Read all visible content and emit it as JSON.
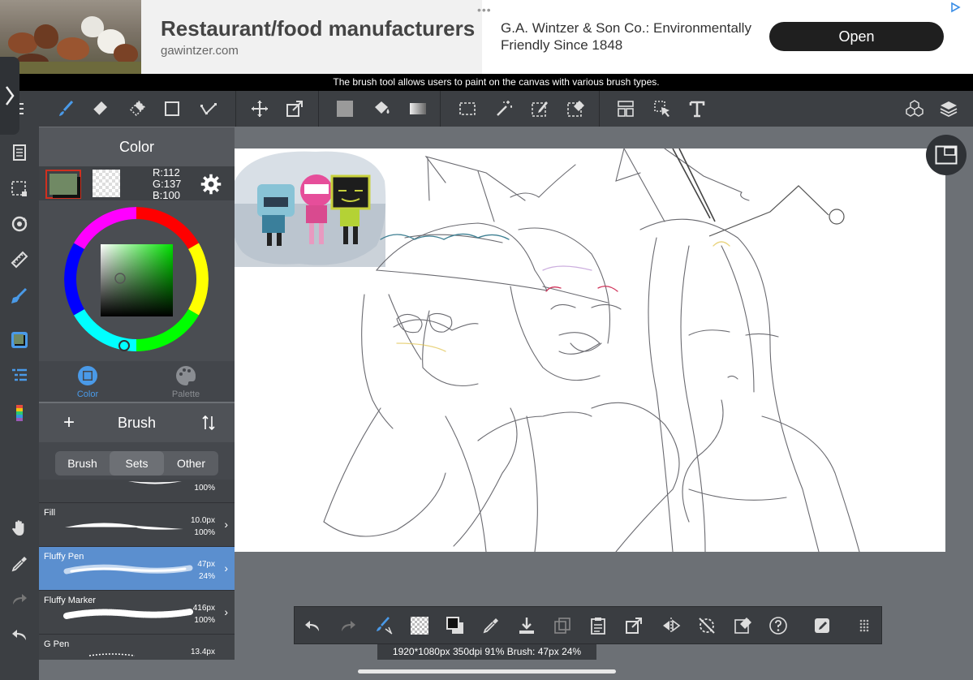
{
  "ad": {
    "title": "Restaurant/food manufacturers",
    "url": "gawintzer.com",
    "description": "G.A. Wintzer & Son Co.: Environmentally Friendly Since 1848",
    "open_label": "Open",
    "dots": "•••"
  },
  "tooltip": "The brush tool allows users to paint on the canvas with various brush types.",
  "color_panel": {
    "title": "Color",
    "rgb": {
      "r": "R:112",
      "g": "G:137",
      "b": "B:100"
    },
    "fg_color": "#708964",
    "tabs": [
      {
        "label": "Color",
        "active": true
      },
      {
        "label": "Palette",
        "active": false
      }
    ]
  },
  "brush_panel": {
    "title": "Brush",
    "add_label": "+",
    "segments": [
      {
        "label": "Brush",
        "active": false
      },
      {
        "label": "Sets",
        "active": true
      },
      {
        "label": "Other",
        "active": false
      }
    ],
    "partial_top": {
      "opacity": "100%"
    },
    "brushes": [
      {
        "name": "Fill",
        "size": "10.0px",
        "opacity": "100%",
        "selected": false
      },
      {
        "name": "Fluffy Pen",
        "size": "47px",
        "opacity": "24%",
        "selected": true
      },
      {
        "name": "Fluffy Marker",
        "size": "416px",
        "opacity": "100%",
        "selected": false
      },
      {
        "name": "G Pen",
        "size": "13.4px",
        "opacity": "",
        "selected": false
      }
    ]
  },
  "status": "1920*1080px 350dpi 91% Brush: 47px 24%",
  "icons": {
    "toolbar": [
      "menu-icon",
      "brush-icon",
      "eraser-icon",
      "blur-icon",
      "shape-icon",
      "lasso-icon",
      "move-icon",
      "transform-icon",
      "fill-color-icon",
      "bucket-icon",
      "gradient-icon",
      "select-rect-icon",
      "magic-wand-icon",
      "select-pen-icon",
      "select-eraser-icon",
      "frame-icon",
      "operation-icon",
      "text-icon",
      "3d-icon",
      "layers-icon"
    ],
    "sidebar": [
      "page-icon",
      "selection-icon",
      "rotate-icon",
      "ruler-icon",
      "pen-icon",
      "color-icon",
      "layer-list-icon",
      "palette-strip-icon",
      "hand-icon",
      "eyedropper-icon",
      "redo-icon",
      "undo-icon"
    ],
    "bottom": [
      "undo-icon",
      "redo-icon",
      "brush-swap-icon",
      "transparent-icon",
      "color-swap-icon",
      "eyedropper-icon",
      "save-icon",
      "copy-icon",
      "paste-icon",
      "export-icon",
      "flip-icon",
      "rotate-reset-icon",
      "clear-icon",
      "help-icon",
      "pen-pressure-icon",
      "more-icon"
    ]
  }
}
